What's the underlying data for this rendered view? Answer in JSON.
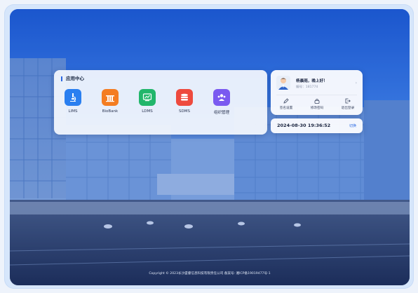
{
  "app_center": {
    "title": "应用中心",
    "apps": [
      {
        "label": "LIMS",
        "icon": "microscope-icon",
        "color": "#2a7ff0"
      },
      {
        "label": "BioBank",
        "icon": "test-tubes-icon",
        "color": "#f47d22"
      },
      {
        "label": "LDMS",
        "icon": "chart-monitor-icon",
        "color": "#22b66b"
      },
      {
        "label": "SDMS",
        "icon": "database-icon",
        "color": "#ee4a3e"
      },
      {
        "label": "组织管理",
        "icon": "people-icon",
        "color": "#7a5af0"
      }
    ]
  },
  "user": {
    "greeting": "杨晨雨，晚上好！",
    "employee_no": "编号：181774",
    "actions": [
      {
        "label": "签名设置",
        "icon": "pen-icon"
      },
      {
        "label": "修改密码",
        "icon": "lock-icon"
      },
      {
        "label": "退出登录",
        "icon": "logout-icon"
      }
    ]
  },
  "clock": {
    "datetime": "2024-08-30 19:36:52",
    "refresh_label": "切换"
  },
  "footer": {
    "copyright": "Copyright © 2023长沙盛睿信息科技有限责任公司 备案号: 湘ICP备19019477号-1"
  },
  "colors": {
    "accent": "#2c66e0"
  }
}
